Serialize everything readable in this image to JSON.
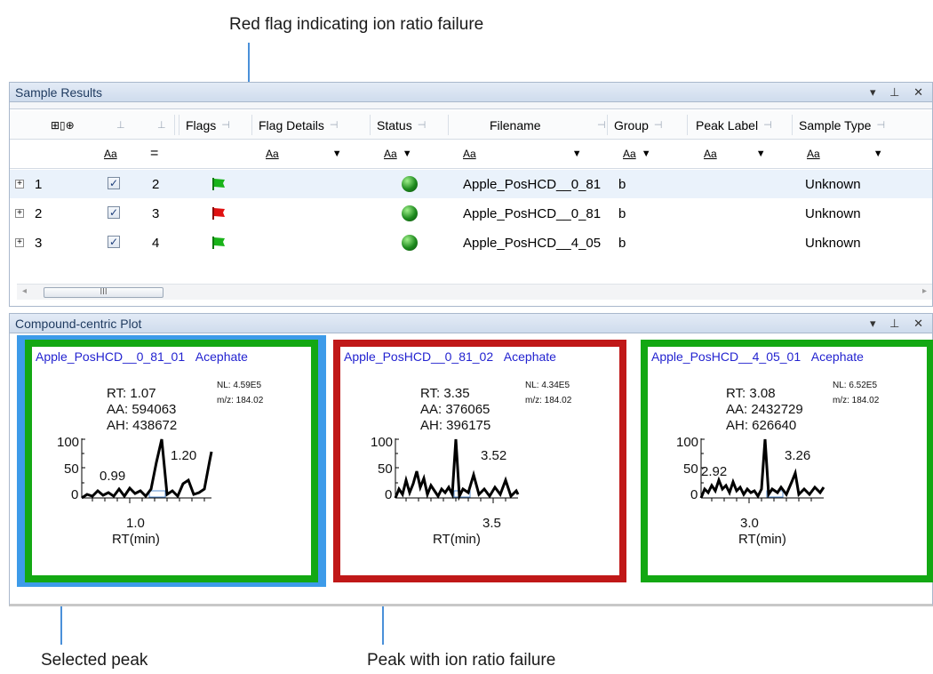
{
  "callouts": {
    "top": "Red flag indicating ion ratio failure",
    "bottom_left": "Selected peak",
    "bottom_mid": "Peak with ion ratio failure"
  },
  "sample_results": {
    "title": "Sample Results",
    "columns": [
      "Flags",
      "Flag Details",
      "Status",
      "Filename",
      "Group",
      "Peak Label",
      "Sample Type"
    ],
    "filter_aa": "Aa",
    "filter_eq": "=",
    "rows": [
      {
        "num": "1",
        "idx": "2",
        "flag": "green",
        "filename": "Apple_PosHCD__0_81",
        "group": "b",
        "sample_type": "Unknown"
      },
      {
        "num": "2",
        "idx": "3",
        "flag": "red",
        "filename": "Apple_PosHCD__0_81",
        "group": "b",
        "sample_type": "Unknown"
      },
      {
        "num": "3",
        "idx": "4",
        "flag": "green",
        "filename": "Apple_PosHCD__4_05",
        "group": "b",
        "sample_type": "Unknown"
      }
    ],
    "scroll_thumb": "III"
  },
  "compound_plot": {
    "title": "Compound-centric Plot",
    "plots": [
      {
        "file": "Apple_PosHCD__0_81_01",
        "compound": "Acephate",
        "nl": "NL: 4.59E5",
        "mz": "m/z: 184.02",
        "rt": "RT: 1.07",
        "aa": "AA: 594063",
        "ah": "AH: 438672",
        "y100": "100",
        "y50": "50",
        "y0": "0",
        "peak_lbl_a": "0.99",
        "peak_lbl_b": "1.20",
        "x_tick": "1.0",
        "xlabel": "RT(min)",
        "frame_color": "#13a813"
      },
      {
        "file": "Apple_PosHCD__0_81_02",
        "compound": "Acephate",
        "nl": "NL: 4.34E5",
        "mz": "m/z: 184.02",
        "rt": "RT: 3.35",
        "aa": "AA: 376065",
        "ah": "AH: 396175",
        "y100": "100",
        "y50": "50",
        "y0": "0",
        "peak_lbl_a": "",
        "peak_lbl_b": "3.52",
        "x_tick": "3.5",
        "xlabel": "RT(min)",
        "frame_color": "#c01818"
      },
      {
        "file": "Apple_PosHCD__4_05_01",
        "compound": "Acephate",
        "nl": "NL: 6.52E5",
        "mz": "m/z: 184.02",
        "rt": "RT: 3.08",
        "aa": "AA: 2432729",
        "ah": "AH: 626640",
        "y100": "100",
        "y50": "50",
        "y0": "0",
        "peak_lbl_a": "2.92",
        "peak_lbl_b": "3.26",
        "x_tick": "3.0",
        "xlabel": "RT(min)",
        "frame_color": "#13a813"
      }
    ]
  },
  "colors": {
    "flag_green": "#19b319",
    "flag_red": "#e01010",
    "selected": "#3d9be9"
  }
}
